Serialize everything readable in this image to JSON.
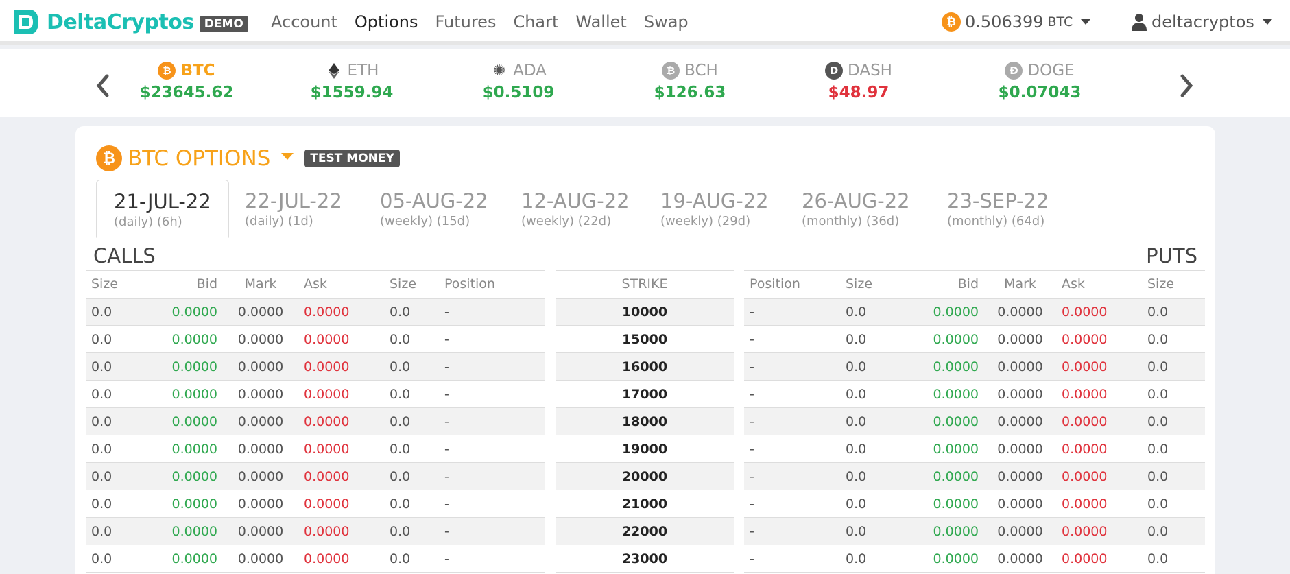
{
  "brand": {
    "name": "DeltaCryptos",
    "badge": "DEMO"
  },
  "nav": [
    {
      "label": "Account",
      "active": false
    },
    {
      "label": "Options",
      "active": true
    },
    {
      "label": "Futures",
      "active": false
    },
    {
      "label": "Chart",
      "active": false
    },
    {
      "label": "Wallet",
      "active": false
    },
    {
      "label": "Swap",
      "active": false
    }
  ],
  "balance": {
    "amount": "0.506399",
    "unit": "BTC"
  },
  "user": {
    "name": "deltacryptos"
  },
  "ticker": [
    {
      "symbol": "BTC",
      "price": "$23645.62",
      "trend": "up",
      "selected": true,
      "icon": "bitcoin-icon",
      "color": "#f7931a",
      "glyph": "₿"
    },
    {
      "symbol": "ETH",
      "price": "$1559.94",
      "trend": "up",
      "selected": false,
      "icon": "ethereum-icon",
      "color": "#333333",
      "glyph": "◆"
    },
    {
      "symbol": "ADA",
      "price": "$0.5109",
      "trend": "up",
      "selected": false,
      "icon": "cardano-icon",
      "color": "#888888",
      "glyph": "✺"
    },
    {
      "symbol": "BCH",
      "price": "$126.63",
      "trend": "up",
      "selected": false,
      "icon": "bitcoin-cash-icon",
      "color": "#aaaaaa",
      "glyph": "₿"
    },
    {
      "symbol": "DASH",
      "price": "$48.97",
      "trend": "down",
      "selected": false,
      "icon": "dash-icon",
      "color": "#555555",
      "glyph": "D"
    },
    {
      "symbol": "DOGE",
      "price": "$0.07043",
      "trend": "up",
      "selected": false,
      "icon": "dogecoin-icon",
      "color": "#aaaaaa",
      "glyph": "Ð"
    }
  ],
  "options": {
    "title": "BTC OPTIONS",
    "badge": "TEST MONEY",
    "expiries": [
      {
        "date": "21-JUL-22",
        "sub": "(daily) (6h)",
        "active": true
      },
      {
        "date": "22-JUL-22",
        "sub": "(daily) (1d)",
        "active": false
      },
      {
        "date": "05-AUG-22",
        "sub": "(weekly) (15d)",
        "active": false
      },
      {
        "date": "12-AUG-22",
        "sub": "(weekly) (22d)",
        "active": false
      },
      {
        "date": "19-AUG-22",
        "sub": "(weekly) (29d)",
        "active": false
      },
      {
        "date": "26-AUG-22",
        "sub": "(monthly) (36d)",
        "active": false
      },
      {
        "date": "23-SEP-22",
        "sub": "(monthly) (64d)",
        "active": false
      }
    ],
    "calls_label": "CALLS",
    "puts_label": "PUTS",
    "calls_columns": [
      "Size",
      "Bid",
      "Mark",
      "Ask",
      "Size",
      "Position"
    ],
    "strike_column": "STRIKE",
    "puts_columns": [
      "Position",
      "Size",
      "Bid",
      "Mark",
      "Ask",
      "Size"
    ],
    "rows": [
      {
        "strike": "10000",
        "call": {
          "size": "0.0",
          "bid": "0.0000",
          "mark": "0.0000",
          "ask": "0.0000",
          "size2": "0.0",
          "position": "-"
        },
        "put": {
          "position": "-",
          "size": "0.0",
          "bid": "0.0000",
          "mark": "0.0000",
          "ask": "0.0000",
          "size2": "0.0"
        }
      },
      {
        "strike": "15000",
        "call": {
          "size": "0.0",
          "bid": "0.0000",
          "mark": "0.0000",
          "ask": "0.0000",
          "size2": "0.0",
          "position": "-"
        },
        "put": {
          "position": "-",
          "size": "0.0",
          "bid": "0.0000",
          "mark": "0.0000",
          "ask": "0.0000",
          "size2": "0.0"
        }
      },
      {
        "strike": "16000",
        "call": {
          "size": "0.0",
          "bid": "0.0000",
          "mark": "0.0000",
          "ask": "0.0000",
          "size2": "0.0",
          "position": "-"
        },
        "put": {
          "position": "-",
          "size": "0.0",
          "bid": "0.0000",
          "mark": "0.0000",
          "ask": "0.0000",
          "size2": "0.0"
        }
      },
      {
        "strike": "17000",
        "call": {
          "size": "0.0",
          "bid": "0.0000",
          "mark": "0.0000",
          "ask": "0.0000",
          "size2": "0.0",
          "position": "-"
        },
        "put": {
          "position": "-",
          "size": "0.0",
          "bid": "0.0000",
          "mark": "0.0000",
          "ask": "0.0000",
          "size2": "0.0"
        }
      },
      {
        "strike": "18000",
        "call": {
          "size": "0.0",
          "bid": "0.0000",
          "mark": "0.0000",
          "ask": "0.0000",
          "size2": "0.0",
          "position": "-"
        },
        "put": {
          "position": "-",
          "size": "0.0",
          "bid": "0.0000",
          "mark": "0.0000",
          "ask": "0.0000",
          "size2": "0.0"
        }
      },
      {
        "strike": "19000",
        "call": {
          "size": "0.0",
          "bid": "0.0000",
          "mark": "0.0000",
          "ask": "0.0000",
          "size2": "0.0",
          "position": "-"
        },
        "put": {
          "position": "-",
          "size": "0.0",
          "bid": "0.0000",
          "mark": "0.0000",
          "ask": "0.0000",
          "size2": "0.0"
        }
      },
      {
        "strike": "20000",
        "call": {
          "size": "0.0",
          "bid": "0.0000",
          "mark": "0.0000",
          "ask": "0.0000",
          "size2": "0.0",
          "position": "-"
        },
        "put": {
          "position": "-",
          "size": "0.0",
          "bid": "0.0000",
          "mark": "0.0000",
          "ask": "0.0000",
          "size2": "0.0"
        }
      },
      {
        "strike": "21000",
        "call": {
          "size": "0.0",
          "bid": "0.0000",
          "mark": "0.0000",
          "ask": "0.0000",
          "size2": "0.0",
          "position": "-"
        },
        "put": {
          "position": "-",
          "size": "0.0",
          "bid": "0.0000",
          "mark": "0.0000",
          "ask": "0.0000",
          "size2": "0.0"
        }
      },
      {
        "strike": "22000",
        "call": {
          "size": "0.0",
          "bid": "0.0000",
          "mark": "0.0000",
          "ask": "0.0000",
          "size2": "0.0",
          "position": "-"
        },
        "put": {
          "position": "-",
          "size": "0.0",
          "bid": "0.0000",
          "mark": "0.0000",
          "ask": "0.0000",
          "size2": "0.0"
        }
      },
      {
        "strike": "23000",
        "call": {
          "size": "0.0",
          "bid": "0.0000",
          "mark": "0.0000",
          "ask": "0.0000",
          "size2": "0.0",
          "position": "-"
        },
        "put": {
          "position": "-",
          "size": "0.0",
          "bid": "0.0000",
          "mark": "0.0000",
          "ask": "0.0000",
          "size2": "0.0"
        }
      }
    ]
  },
  "colors": {
    "brand": "#1bbfb3",
    "btc": "#f7931a",
    "up": "#2fa84f",
    "down": "#e0323c"
  }
}
